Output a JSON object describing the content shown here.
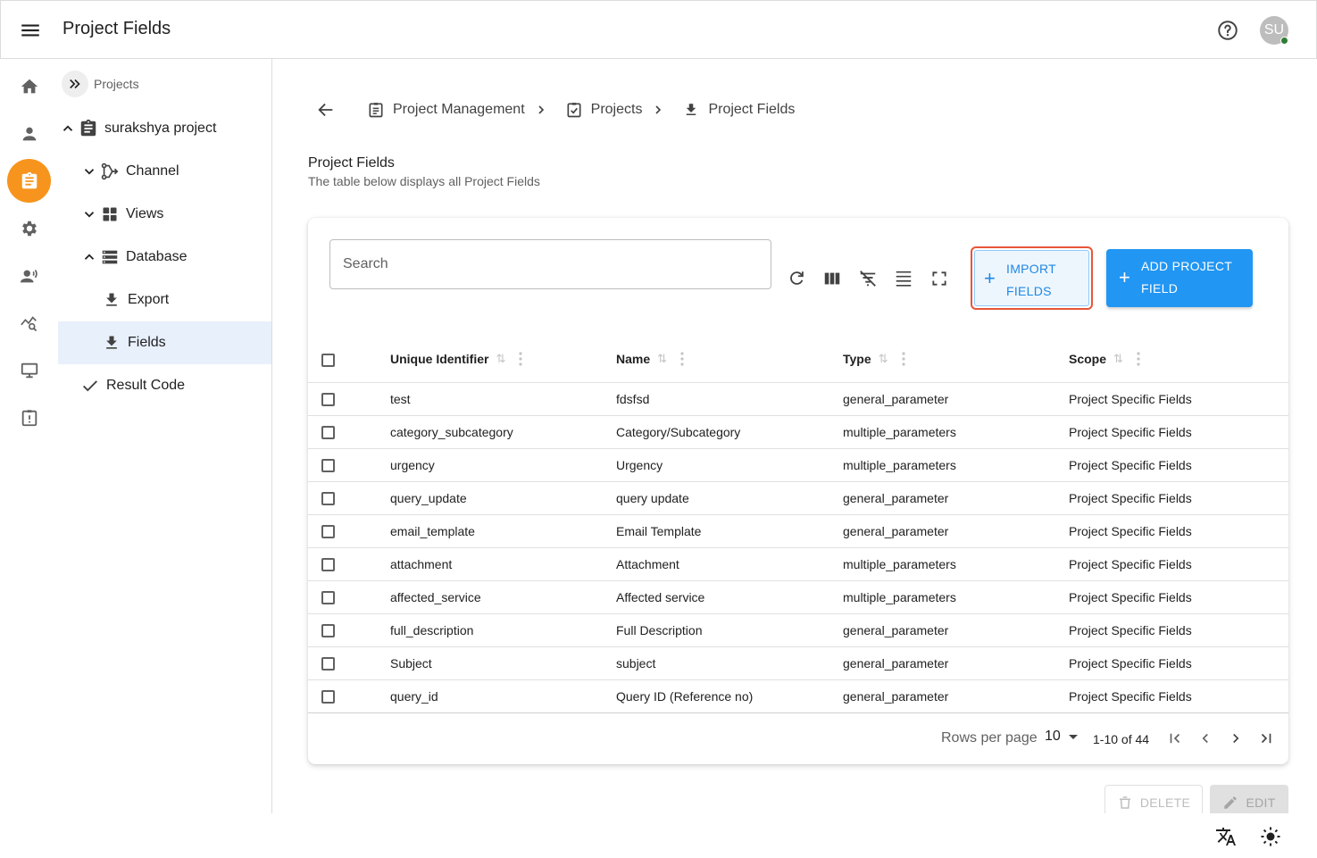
{
  "appbar": {
    "title": "Project Fields",
    "avatar_initials": "SU"
  },
  "rail": {
    "items": [
      {
        "icon": "home-icon"
      },
      {
        "icon": "person-icon"
      },
      {
        "icon": "clipboard-icon",
        "active": true
      },
      {
        "icon": "gear-icon"
      },
      {
        "icon": "record-voice-icon"
      },
      {
        "icon": "analytics-search-icon"
      },
      {
        "icon": "monitor-icon"
      },
      {
        "icon": "report-clipboard-icon"
      }
    ],
    "accent": "#f7941d"
  },
  "tree": {
    "crumb": "Projects",
    "nodes": [
      {
        "label": "surakshya project"
      },
      {
        "label": "Channel"
      },
      {
        "label": "Views"
      },
      {
        "label": "Database"
      },
      {
        "label": "Export"
      },
      {
        "label": "Fields",
        "selected": true
      },
      {
        "label": "Result Code"
      }
    ]
  },
  "breadcrumb": [
    {
      "label": "Project Management"
    },
    {
      "label": "Projects"
    },
    {
      "label": "Project Fields"
    }
  ],
  "page": {
    "title": "Project Fields",
    "subtitle": "The table below displays all Project Fields"
  },
  "toolbar": {
    "search_placeholder": "Search",
    "import_label": "IMPORT FIELDS",
    "add_label": "ADD PROJECT FIELD"
  },
  "table": {
    "columns": [
      "Unique Identifier",
      "Name",
      "Type",
      "Scope"
    ],
    "rows": [
      [
        "test",
        "fdsfsd",
        "general_parameter",
        "Project Specific Fields"
      ],
      [
        "category_subcategory",
        "Category/Subcategory",
        "multiple_parameters",
        "Project Specific Fields"
      ],
      [
        "urgency",
        "Urgency",
        "multiple_parameters",
        "Project Specific Fields"
      ],
      [
        "query_update",
        "query update",
        "general_parameter",
        "Project Specific Fields"
      ],
      [
        "email_template",
        "Email Template",
        "general_parameter",
        "Project Specific Fields"
      ],
      [
        "attachment",
        "Attachment",
        "multiple_parameters",
        "Project Specific Fields"
      ],
      [
        "affected_service",
        "Affected service",
        "multiple_parameters",
        "Project Specific Fields"
      ],
      [
        "full_description",
        "Full Description",
        "general_parameter",
        "Project Specific Fields"
      ],
      [
        "Subject",
        "subject",
        "general_parameter",
        "Project Specific Fields"
      ],
      [
        "query_id",
        "Query ID (Reference no)",
        "general_parameter",
        "Project Specific Fields"
      ]
    ]
  },
  "pagination": {
    "rows_per_page_label": "Rows per page",
    "rows_per_page": "10",
    "range": "1-10 of 44"
  },
  "actions": {
    "delete_label": "DELETE",
    "edit_label": "EDIT"
  },
  "colors": {
    "primary": "#2196f3",
    "import_outline": "#e8553a",
    "selected_row": "#e8f0fb"
  }
}
